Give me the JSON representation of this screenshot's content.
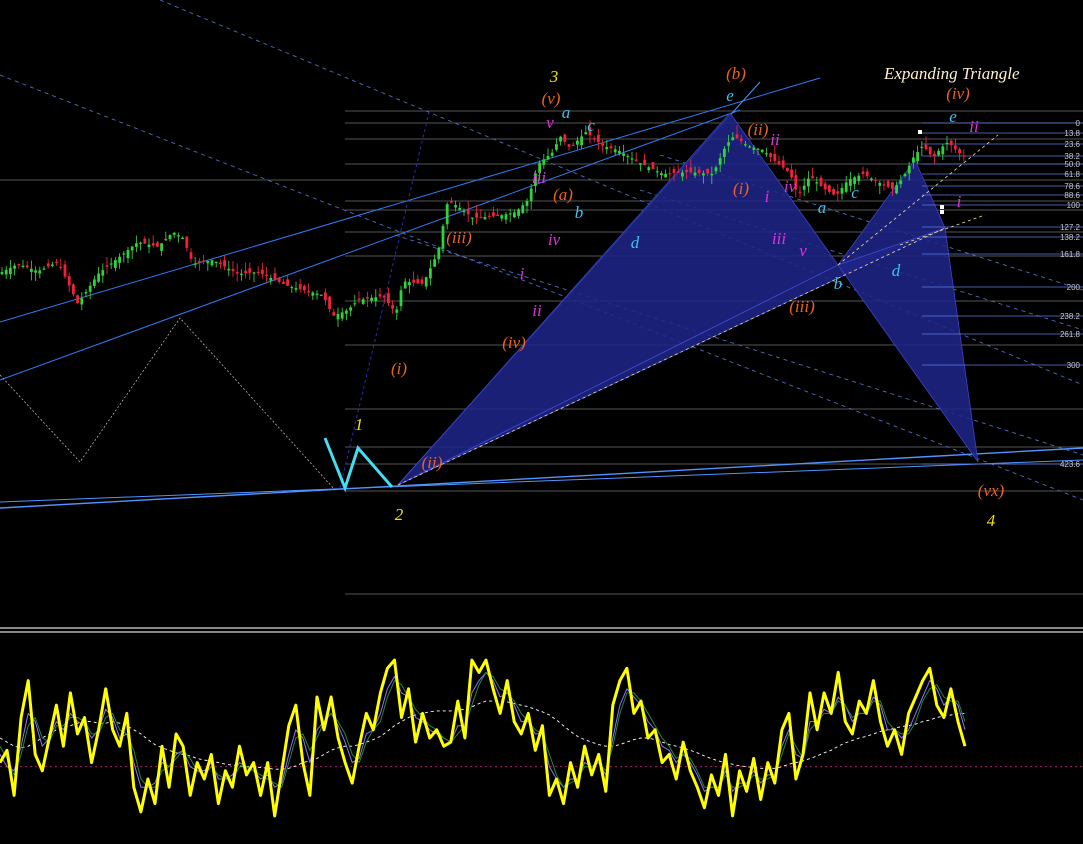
{
  "chart_data": [
    {
      "type": "candlestick",
      "title": "Expanding Triangle",
      "price_scale": "0-1 normalised price (no price axis printed)",
      "colors": {
        "up": "#2fd13c",
        "down": "#f2203a",
        "background": "#000000",
        "harmonic_fill": "#1f2488",
        "trend_lines": "#2f7cf0",
        "zigzag_cyan": "#44dcf0"
      },
      "price_path": [
        [
          0,
          0.56
        ],
        [
          20,
          0.585
        ],
        [
          40,
          0.567
        ],
        [
          60,
          0.59
        ],
        [
          80,
          0.485
        ],
        [
          100,
          0.56
        ],
        [
          120,
          0.6
        ],
        [
          140,
          0.64
        ],
        [
          160,
          0.628
        ],
        [
          175,
          0.665
        ],
        [
          185,
          0.65
        ],
        [
          195,
          0.585
        ],
        [
          215,
          0.595
        ],
        [
          240,
          0.56
        ],
        [
          260,
          0.565
        ],
        [
          290,
          0.53
        ],
        [
          325,
          0.507
        ],
        [
          335,
          0.455
        ],
        [
          350,
          0.47
        ],
        [
          360,
          0.495
        ],
        [
          385,
          0.505
        ],
        [
          398,
          0.462
        ],
        [
          405,
          0.542
        ],
        [
          425,
          0.535
        ],
        [
          440,
          0.615
        ],
        [
          450,
          0.745
        ],
        [
          462,
          0.725
        ],
        [
          475,
          0.7
        ],
        [
          500,
          0.705
        ],
        [
          518,
          0.715
        ],
        [
          530,
          0.745
        ],
        [
          540,
          0.835
        ],
        [
          555,
          0.865
        ],
        [
          562,
          0.905
        ],
        [
          572,
          0.875
        ],
        [
          588,
          0.915
        ],
        [
          605,
          0.88
        ],
        [
          620,
          0.87
        ],
        [
          640,
          0.84
        ],
        [
          665,
          0.81
        ],
        [
          690,
          0.815
        ],
        [
          715,
          0.81
        ],
        [
          728,
          0.882
        ],
        [
          736,
          0.905
        ],
        [
          750,
          0.88
        ],
        [
          765,
          0.87
        ],
        [
          778,
          0.84
        ],
        [
          792,
          0.813
        ],
        [
          800,
          0.755
        ],
        [
          812,
          0.805
        ],
        [
          825,
          0.775
        ],
        [
          838,
          0.755
        ],
        [
          850,
          0.795
        ],
        [
          865,
          0.81
        ],
        [
          880,
          0.79
        ],
        [
          895,
          0.772
        ],
        [
          905,
          0.8
        ],
        [
          915,
          0.85
        ],
        [
          925,
          0.882
        ],
        [
          935,
          0.85
        ],
        [
          943,
          0.875
        ],
        [
          950,
          0.89
        ],
        [
          958,
          0.87
        ],
        [
          966,
          0.853
        ]
      ],
      "fibonacci_levels": [
        "0",
        "13.8",
        "23.6",
        "38.2",
        "50.0",
        "61.8",
        "78.6",
        "88.6",
        "100",
        "127.2",
        "138.2",
        "161.8",
        "200",
        "238.2",
        "261.8",
        "300",
        "423.6"
      ],
      "wave_labels": [
        {
          "text": "3",
          "color": "#f0e010"
        },
        {
          "text": "(v)",
          "color": "#f06020"
        },
        {
          "text": "v",
          "color": "#e030e0"
        },
        {
          "text": "a",
          "color": "#40c0f0"
        },
        {
          "text": "c",
          "color": "#40c0f0"
        },
        {
          "text": "iii",
          "color": "#e030e0"
        },
        {
          "text": "(a)",
          "color": "#f06020"
        },
        {
          "text": "b",
          "color": "#40c0f0"
        },
        {
          "text": "iv",
          "color": "#e030e0"
        },
        {
          "text": "d",
          "color": "#40c0f0"
        },
        {
          "text": "(iii)",
          "color": "#f06020"
        },
        {
          "text": "i",
          "color": "#e030e0"
        },
        {
          "text": "ii",
          "color": "#e030e0"
        },
        {
          "text": "(iv)",
          "color": "#f06020"
        },
        {
          "text": "(i)",
          "color": "#f06020"
        },
        {
          "text": "1",
          "color": "#f0e010"
        },
        {
          "text": "(ii)",
          "color": "#f06020"
        },
        {
          "text": "2",
          "color": "#f0e010"
        },
        {
          "text": "(b)",
          "color": "#f06020"
        },
        {
          "text": "e",
          "color": "#40c0f0"
        },
        {
          "text": "(ii)",
          "color": "#f06020"
        },
        {
          "text": "ii",
          "color": "#e030e0"
        },
        {
          "text": "(i)",
          "color": "#f06020"
        },
        {
          "text": "i",
          "color": "#e030e0"
        },
        {
          "text": "iv",
          "color": "#e030e0"
        },
        {
          "text": "iii",
          "color": "#e030e0"
        },
        {
          "text": "v",
          "color": "#e030e0"
        },
        {
          "text": "(iii)",
          "color": "#f06020"
        },
        {
          "text": "a",
          "color": "#40c0f0"
        },
        {
          "text": "b",
          "color": "#40c0f0"
        },
        {
          "text": "c",
          "color": "#40c0f0"
        },
        {
          "text": "d",
          "color": "#40c0f0"
        },
        {
          "text": "(iv)",
          "color": "#f06020"
        },
        {
          "text": "e",
          "color": "#40c0f0"
        },
        {
          "text": "ii",
          "color": "#e030e0"
        },
        {
          "text": "i",
          "color": "#e030e0"
        },
        {
          "text": "(vx)",
          "color": "#f06020"
        },
        {
          "text": "4",
          "color": "#f0e010"
        }
      ]
    },
    {
      "type": "line",
      "title": "",
      "ylim": [
        -1,
        1
      ],
      "grid": false,
      "reference_line": {
        "color": "#c0207a",
        "value": -0.35
      },
      "series": [
        {
          "color": "#ffff00",
          "values": [
            -0.3,
            -0.15,
            -0.7,
            0.25,
            0.7,
            -0.2,
            -0.4,
            0.0,
            0.4,
            -0.1,
            0.55,
            0.05,
            0.25,
            -0.3,
            0.1,
            0.6,
            0.1,
            -0.1,
            0.3,
            -0.6,
            -0.9,
            -0.5,
            -0.8,
            -0.1,
            -0.6,
            0.05,
            -0.1,
            -0.7,
            -0.3,
            -0.5,
            -0.2,
            -0.8,
            -0.4,
            -0.6,
            -0.1,
            -0.45,
            -0.3,
            -0.7,
            -0.3,
            -0.95,
            -0.4,
            0.15,
            0.4,
            -0.3,
            -0.7,
            0.5,
            0.1,
            0.5,
            0.0,
            -0.3,
            -0.55,
            -0.1,
            0.3,
            0.1,
            0.55,
            0.85,
            0.95,
            0.25,
            0.6,
            -0.05,
            0.3,
            0.0,
            0.1,
            -0.1,
            -0.05,
            0.45,
            0.0,
            0.95,
            0.8,
            0.95,
            0.6,
            0.3,
            0.7,
            0.2,
            0.05,
            0.3,
            -0.15,
            0.15,
            -0.7,
            -0.5,
            -0.8,
            -0.3,
            -0.6,
            -0.1,
            -0.45,
            -0.2,
            -0.65,
            0.4,
            0.7,
            0.85,
            0.3,
            0.45,
            0.0,
            0.1,
            -0.3,
            -0.2,
            -0.5,
            -0.05,
            -0.4,
            -0.6,
            -0.85,
            -0.45,
            -0.7,
            -0.2,
            -0.95,
            -0.4,
            -0.65,
            -0.25,
            -0.75,
            -0.3,
            -0.55,
            0.1,
            0.3,
            -0.5,
            -0.2,
            0.55,
            0.1,
            0.55,
            0.3,
            0.8,
            0.2,
            0.05,
            0.45,
            0.3,
            0.7,
            0.2,
            -0.1,
            0.1,
            -0.2,
            0.3,
            0.5,
            0.7,
            0.85,
            0.4,
            0.25,
            0.6,
            0.2,
            -0.1
          ]
        },
        {
          "color": "#9070ff",
          "values": [
            -0.2,
            -0.35,
            -0.4,
            -0.1,
            0.3,
            0.2,
            -0.1,
            0.0,
            0.2,
            0.1,
            0.3,
            0.2,
            0.15,
            0.0,
            0.1,
            0.35,
            0.25,
            0.0,
            0.05,
            -0.3,
            -0.6,
            -0.6,
            -0.55,
            -0.3,
            -0.35,
            -0.2,
            -0.15,
            -0.35,
            -0.4,
            -0.4,
            -0.3,
            -0.5,
            -0.5,
            -0.45,
            -0.3,
            -0.35,
            -0.4,
            -0.5,
            -0.45,
            -0.6,
            -0.55,
            -0.2,
            0.1,
            0.0,
            -0.3,
            0.1,
            0.2,
            0.3,
            0.15,
            -0.05,
            -0.3,
            -0.25,
            0.05,
            0.1,
            0.3,
            0.6,
            0.75,
            0.55,
            0.5,
            0.25,
            0.2,
            0.1,
            0.05,
            0.0,
            -0.05,
            0.15,
            0.15,
            0.55,
            0.7,
            0.8,
            0.7,
            0.5,
            0.55,
            0.4,
            0.2,
            0.2,
            0.05,
            0.05,
            -0.35,
            -0.5,
            -0.6,
            -0.5,
            -0.5,
            -0.3,
            -0.35,
            -0.3,
            -0.45,
            0.0,
            0.4,
            0.6,
            0.5,
            0.4,
            0.2,
            0.1,
            -0.1,
            -0.15,
            -0.3,
            -0.2,
            -0.3,
            -0.45,
            -0.65,
            -0.6,
            -0.6,
            -0.4,
            -0.65,
            -0.55,
            -0.55,
            -0.4,
            -0.55,
            -0.45,
            -0.45,
            -0.1,
            0.1,
            -0.2,
            -0.25,
            0.2,
            0.2,
            0.35,
            0.3,
            0.5,
            0.4,
            0.2,
            0.3,
            0.3,
            0.5,
            0.4,
            0.1,
            0.1,
            0.0,
            0.1,
            0.3,
            0.5,
            0.7,
            0.6,
            0.4,
            0.5,
            0.4,
            0.1
          ]
        },
        {
          "color": "#208a3a",
          "values": [
            -0.1,
            -0.25,
            -0.45,
            -0.2,
            0.15,
            0.25,
            0.0,
            -0.05,
            0.15,
            0.15,
            0.25,
            0.25,
            0.2,
            0.05,
            0.05,
            0.25,
            0.3,
            0.1,
            0.05,
            -0.15,
            -0.5,
            -0.6,
            -0.6,
            -0.4,
            -0.35,
            -0.25,
            -0.15,
            -0.25,
            -0.4,
            -0.45,
            -0.35,
            -0.45,
            -0.5,
            -0.5,
            -0.35,
            -0.35,
            -0.4,
            -0.45,
            -0.5,
            -0.55,
            -0.6,
            -0.3,
            0.0,
            0.05,
            -0.15,
            0.0,
            0.2,
            0.3,
            0.2,
            0.05,
            -0.2,
            -0.3,
            -0.05,
            0.1,
            0.2,
            0.5,
            0.7,
            0.65,
            0.5,
            0.35,
            0.25,
            0.15,
            0.1,
            0.0,
            -0.05,
            0.05,
            0.15,
            0.4,
            0.65,
            0.8,
            0.75,
            0.6,
            0.55,
            0.45,
            0.3,
            0.2,
            0.1,
            0.05,
            -0.2,
            -0.45,
            -0.6,
            -0.55,
            -0.5,
            -0.35,
            -0.35,
            -0.3,
            -0.4,
            -0.1,
            0.3,
            0.55,
            0.55,
            0.45,
            0.3,
            0.15,
            0.0,
            -0.1,
            -0.25,
            -0.2,
            -0.25,
            -0.4,
            -0.6,
            -0.6,
            -0.6,
            -0.45,
            -0.6,
            -0.6,
            -0.55,
            -0.45,
            -0.5,
            -0.5,
            -0.45,
            -0.2,
            0.05,
            -0.1,
            -0.25,
            0.1,
            0.2,
            0.3,
            0.3,
            0.45,
            0.4,
            0.25,
            0.3,
            0.3,
            0.45,
            0.45,
            0.2,
            0.1,
            0.05,
            0.05,
            0.2,
            0.45,
            0.6,
            0.65,
            0.5,
            0.45,
            0.45,
            0.2
          ]
        },
        {
          "color": "#ffffff",
          "style": "dashed",
          "values": [
            0.0,
            -0.05,
            -0.1,
            -0.12,
            -0.1,
            -0.05,
            0.0,
            0.05,
            0.1,
            0.12,
            0.15,
            0.18,
            0.2,
            0.2,
            0.18,
            0.18,
            0.2,
            0.18,
            0.15,
            0.1,
            0.05,
            -0.02,
            -0.08,
            -0.12,
            -0.15,
            -0.18,
            -0.2,
            -0.22,
            -0.25,
            -0.27,
            -0.28,
            -0.3,
            -0.32,
            -0.33,
            -0.34,
            -0.35,
            -0.35,
            -0.36,
            -0.37,
            -0.38,
            -0.38,
            -0.37,
            -0.34,
            -0.3,
            -0.28,
            -0.25,
            -0.2,
            -0.15,
            -0.12,
            -0.1,
            -0.1,
            -0.08,
            -0.05,
            -0.02,
            0.02,
            0.08,
            0.15,
            0.2,
            0.25,
            0.28,
            0.3,
            0.32,
            0.33,
            0.33,
            0.33,
            0.34,
            0.35,
            0.38,
            0.42,
            0.45,
            0.45,
            0.45,
            0.44,
            0.42,
            0.4,
            0.38,
            0.35,
            0.32,
            0.28,
            0.22,
            0.15,
            0.08,
            0.02,
            -0.02,
            -0.05,
            -0.08,
            -0.1,
            -0.1,
            -0.08,
            -0.05,
            -0.02,
            0.0,
            0.0,
            -0.02,
            -0.05,
            -0.08,
            -0.1,
            -0.12,
            -0.15,
            -0.18,
            -0.22,
            -0.25,
            -0.28,
            -0.3,
            -0.32,
            -0.34,
            -0.35,
            -0.36,
            -0.37,
            -0.37,
            -0.37,
            -0.35,
            -0.32,
            -0.3,
            -0.28,
            -0.25,
            -0.22,
            -0.18,
            -0.15,
            -0.1,
            -0.06,
            -0.03,
            0.0,
            0.02,
            0.05,
            0.08,
            0.1,
            0.12,
            0.14,
            0.15,
            0.17,
            0.2,
            0.22,
            0.25,
            0.27,
            0.28,
            0.3,
            0.3
          ]
        }
      ]
    }
  ]
}
